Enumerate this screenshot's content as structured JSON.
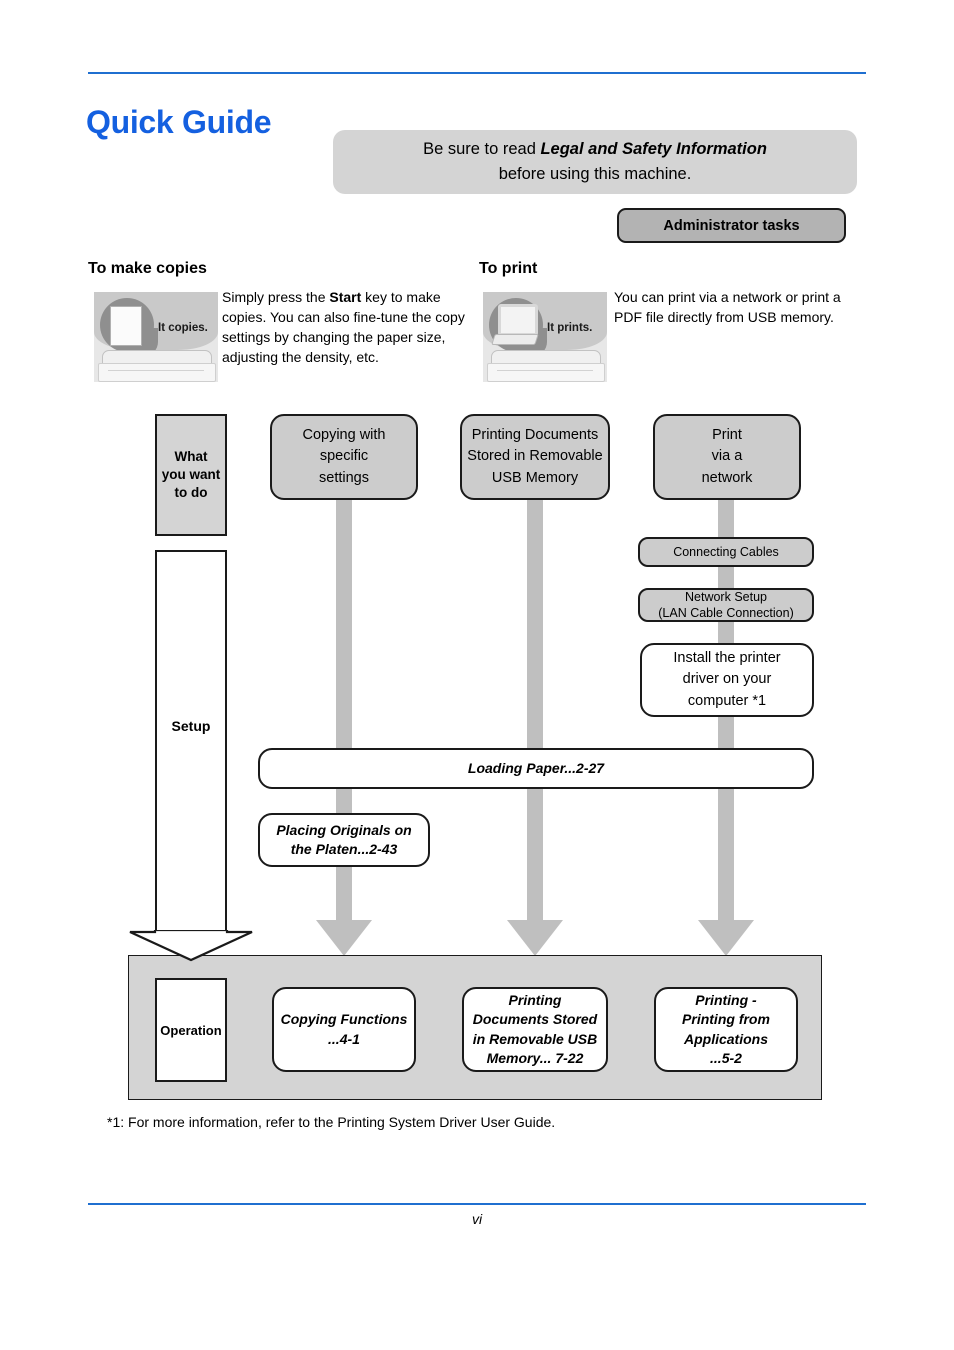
{
  "document": {
    "title": "Quick Guide",
    "page_number": "vi",
    "footnote": "*1: For more information, refer to the Printing System Driver User Guide.",
    "accent_color": "#1460e0",
    "rule_color": "#1f6fd0"
  },
  "notice": {
    "line1_prefix": "Be sure to read ",
    "line1_emphasis": "Legal and Safety Information",
    "line2": "before using this machine."
  },
  "admin_button": {
    "label": "Administrator tasks"
  },
  "features": [
    {
      "heading": "To make copies",
      "body_prefix": "Simply press the ",
      "body_emphasis": "Start",
      "body_suffix": " key to make copies. You can also fine-tune the copy settings by changing the paper size, adjusting the density, etc.",
      "photo_label": "It copies.",
      "photo_icon": "document-sheet-icon"
    },
    {
      "heading": "To print",
      "body_prefix": "",
      "body_emphasis": "",
      "body_suffix": "You can print via a network or print a PDF file directly from USB memory.",
      "photo_label": "It prints.",
      "photo_icon": "computer-monitor-icon"
    }
  ],
  "flowchart": {
    "stages": {
      "what_you_want_to_do": "What\nyou want\nto do",
      "setup": "Setup",
      "operation": "Operation"
    },
    "columns": [
      {
        "goal": "Copying with\nspecific\nsettings",
        "result": "Copying Functions\n...4-1"
      },
      {
        "goal": "Printing Documents\nStored in Removable\nUSB Memory",
        "result": "Printing\nDocuments Stored\nin Removable USB\nMemory... 7-22"
      },
      {
        "goal": "Print\nvia a\nnetwork",
        "result": "Printing -\nPrinting from\nApplications\n...5-2"
      }
    ],
    "setup_steps": {
      "connecting_cables": "Connecting Cables",
      "network_setup": "Network Setup\n(LAN Cable Connection)",
      "install_driver": "Install the printer\ndriver on your\ncomputer   *1",
      "loading_paper": "Loading Paper...2-27",
      "placing_originals": "Placing Originals on\nthe Platen...2-43"
    }
  }
}
